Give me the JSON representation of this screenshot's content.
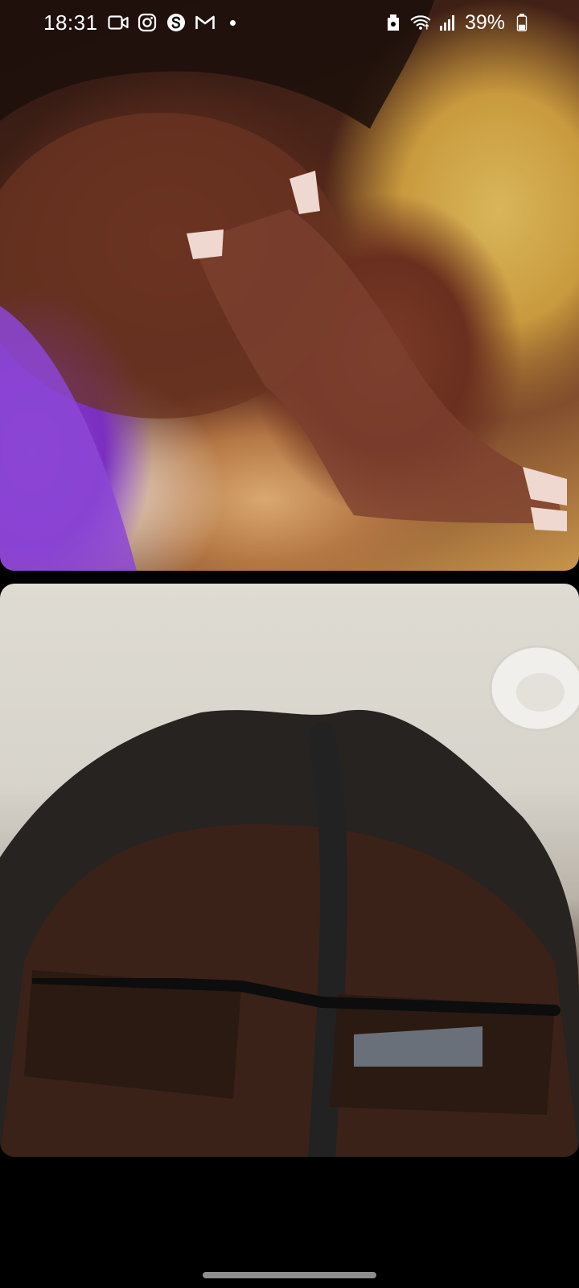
{
  "status_bar": {
    "time": "18:31",
    "notification_icons": [
      "video-camera-icon",
      "instagram-icon",
      "s-app-icon",
      "gmail-icon"
    ],
    "more_notifications_dot": true,
    "system_icons": [
      "data-saver-icon",
      "wifi-icon",
      "signal-icon"
    ],
    "battery_percent": "39%",
    "battery_level": 0.39
  },
  "call": {
    "remote_video": {
      "visible": true
    },
    "local_video": {
      "visible": true
    }
  },
  "colors": {
    "background": "#000000",
    "status_text": "#ffffff",
    "nav_handle": "#8e8e8e"
  }
}
